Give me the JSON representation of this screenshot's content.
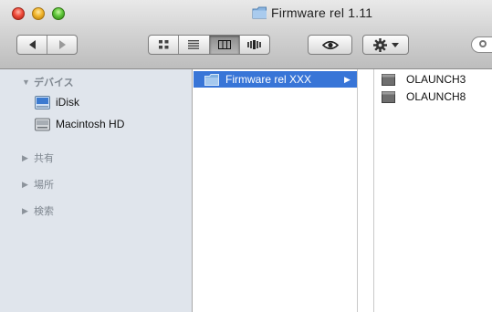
{
  "window": {
    "title": "Firmware rel 1.11"
  },
  "toolbar": {
    "nav_back_icon": "back-arrow-icon",
    "nav_forward_icon": "forward-arrow-icon",
    "view_modes": [
      "icon-view",
      "list-view",
      "column-view",
      "cover-flow-view"
    ],
    "active_view": "column-view",
    "quicklook_icon": "eye-icon",
    "action_icon": "gear-icon"
  },
  "sidebar": {
    "sections": [
      {
        "label": "デバイス",
        "expanded": true
      },
      {
        "label": "共有",
        "expanded": false
      },
      {
        "label": "場所",
        "expanded": false
      },
      {
        "label": "検索",
        "expanded": false
      }
    ],
    "devices": [
      {
        "label": "iDisk",
        "icon": "idisk-icon"
      },
      {
        "label": "Macintosh HD",
        "icon": "hard-drive-icon"
      }
    ]
  },
  "columns": {
    "col1": [
      {
        "label": "Firmware rel XXX",
        "selected": true,
        "icon": "folder-icon"
      }
    ],
    "col3": [
      {
        "label": "OLAUNCH3",
        "icon": "document-icon"
      },
      {
        "label": "OLAUNCH8",
        "icon": "document-icon"
      }
    ]
  },
  "colors": {
    "selection": "#3875d7",
    "sidebar_bg": "#e0e5ec",
    "folder_blue": "#6fa6da"
  }
}
